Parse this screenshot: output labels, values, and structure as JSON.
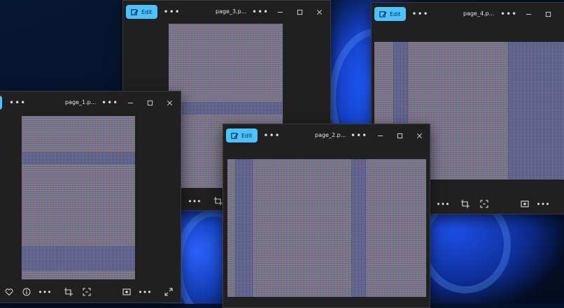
{
  "windows": {
    "page_3": {
      "title": "page_3.p...",
      "edit_label": "Edit"
    },
    "page_4": {
      "title": "page_4.p...",
      "edit_label": "Edit"
    },
    "page_1": {
      "title": "page_1.p...",
      "edit_label": "Edit"
    },
    "page_2": {
      "title": "page_2.p...",
      "edit_label": "Edit"
    }
  },
  "icons": {
    "more": "more-options-icon",
    "minimize": "minimize-icon",
    "maximize": "maximize-icon",
    "close": "close-icon",
    "favorite": "heart-icon",
    "info": "info-icon",
    "crop": "crop-icon",
    "scan": "scan-text-icon",
    "slideshow": "slideshow-icon",
    "fullscreen": "expand-icon"
  },
  "colors": {
    "edit_button": "#4cc2ff",
    "window_bg": "#202020",
    "desktop_bg": "#05122b"
  }
}
